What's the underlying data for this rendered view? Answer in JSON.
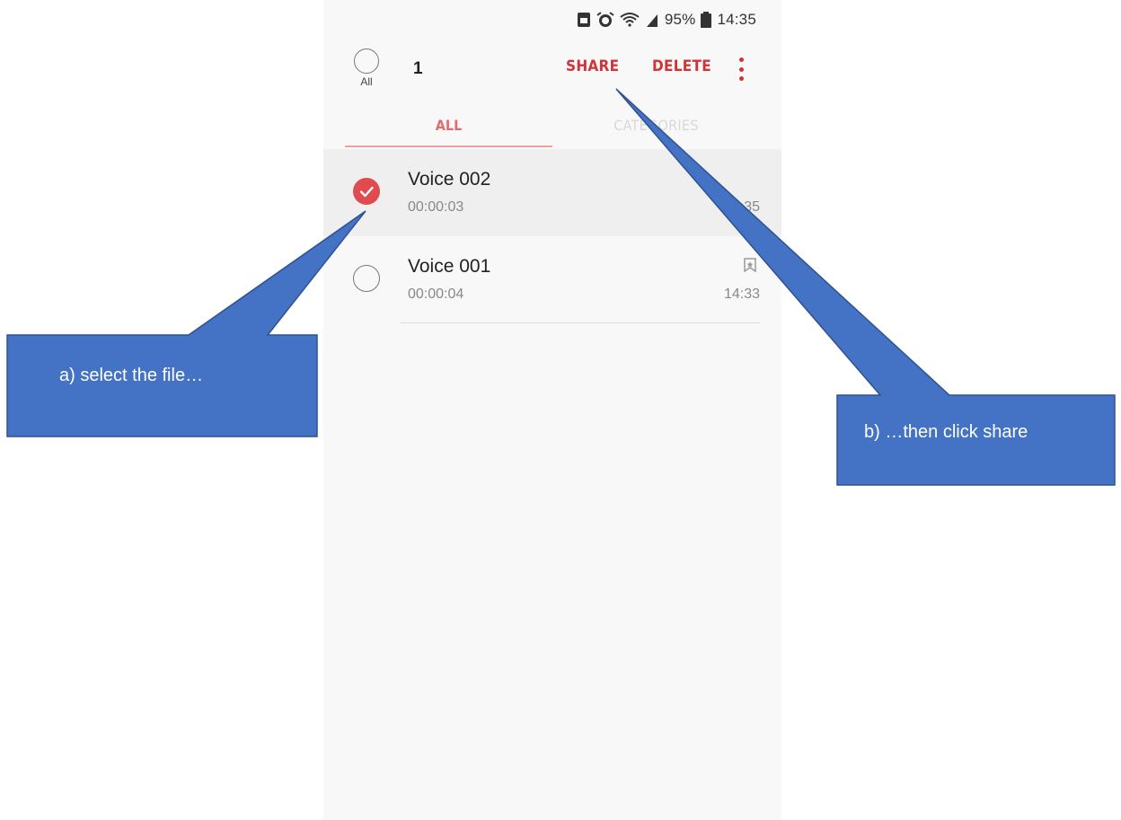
{
  "statusbar": {
    "battery": "95%",
    "time": "14:35"
  },
  "actionbar": {
    "select_all_label": "All",
    "selected_count": "1",
    "share_label": "SHARE",
    "delete_label": "DELETE"
  },
  "tabs": [
    {
      "label": "ALL",
      "active": true
    },
    {
      "label": "CATEGORIES",
      "active": false
    }
  ],
  "recordings": [
    {
      "title": "Voice 002",
      "duration": "00:00:03",
      "time": "14:35",
      "selected": true
    },
    {
      "title": "Voice 001",
      "duration": "00:00:04",
      "time": "14:33",
      "selected": false,
      "bookmarked": true
    }
  ],
  "callouts": {
    "a": "a)    select the file…",
    "b": "b) …then click share"
  },
  "colors": {
    "accent": "#d0343a",
    "callout_fill": "#4472c4",
    "callout_border": "#2f528f"
  }
}
